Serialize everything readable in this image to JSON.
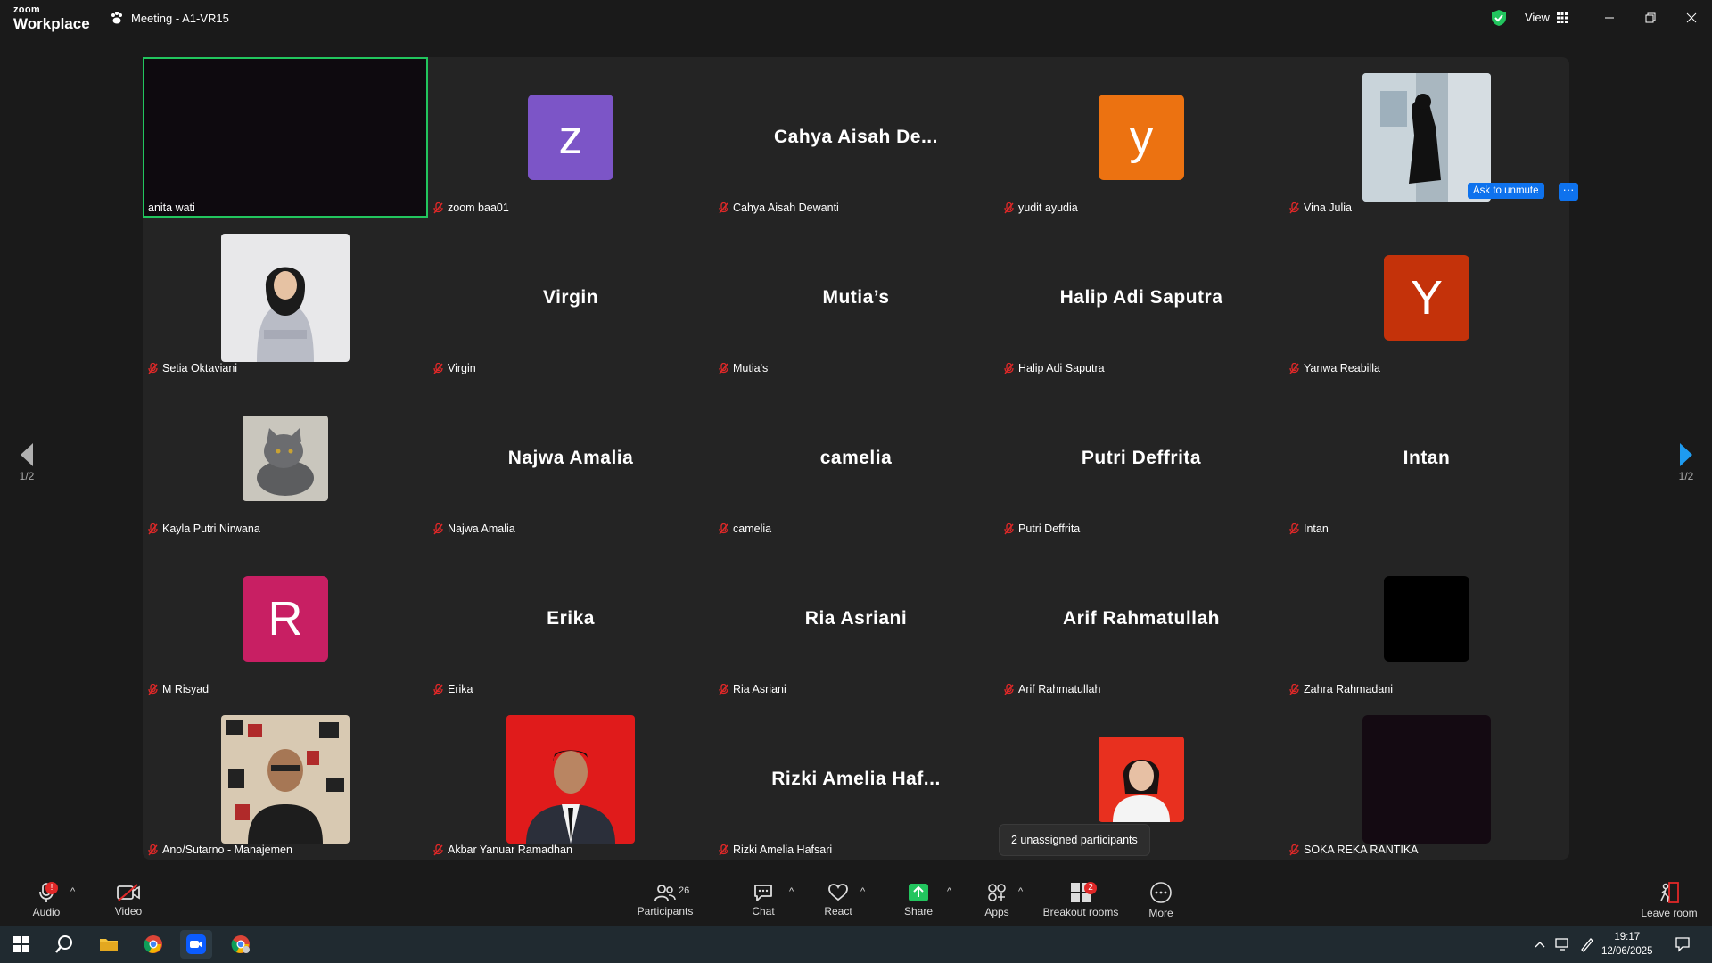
{
  "app": {
    "brand_top": "zoom",
    "brand_bottom": "Workplace",
    "meeting_title": "Meeting - A1-VR15",
    "view_label": "View"
  },
  "tiles": [
    {
      "label": "anita wati",
      "kind": "dark",
      "muted": false,
      "active": true
    },
    {
      "label": "zoom baa01",
      "kind": "avatar",
      "letter": "z",
      "color": "#7c55c7",
      "muted": true
    },
    {
      "label": "Cahya Aisah Dewanti",
      "kind": "name",
      "display": "Cahya  Aisah  De...",
      "muted": true
    },
    {
      "label": "yudit ayudia",
      "kind": "avatar",
      "letter": "y",
      "color": "#ec7211",
      "muted": true
    },
    {
      "label": "Vina Julia",
      "kind": "photo",
      "photo": "mirror-selfie",
      "muted": true
    },
    {
      "label": "Setia Oktaviani",
      "kind": "photo",
      "photo": "hijab-portrait",
      "muted": true
    },
    {
      "label": "Virgin",
      "kind": "name",
      "display": "Virgin",
      "muted": true
    },
    {
      "label": "Mutia's",
      "kind": "name",
      "display": "Mutia’s",
      "muted": true
    },
    {
      "label": "Halip Adi Saputra",
      "kind": "name",
      "display": "Halip Adi Saputra",
      "muted": true
    },
    {
      "label": "Yanwa Reabilla",
      "kind": "avatar",
      "letter": "Y",
      "color": "#c4320a",
      "muted": true
    },
    {
      "label": "Kayla Putri Nirwana",
      "kind": "photo-small",
      "photo": "cat",
      "muted": true
    },
    {
      "label": "Najwa Amalia",
      "kind": "name",
      "display": "Najwa Amalia",
      "muted": true
    },
    {
      "label": "camelia",
      "kind": "name",
      "display": "camelia",
      "muted": true
    },
    {
      "label": "Putri Deffrita",
      "kind": "name",
      "display": "Putri Deffrita",
      "muted": true
    },
    {
      "label": "Intan",
      "kind": "name",
      "display": "Intan",
      "muted": true
    },
    {
      "label": "M Risyad",
      "kind": "avatar",
      "letter": "R",
      "color": "#c81f63",
      "muted": true
    },
    {
      "label": "Erika",
      "kind": "name",
      "display": "Erika",
      "muted": true
    },
    {
      "label": "Ria Asriani",
      "kind": "name",
      "display": "Ria Asriani",
      "muted": true
    },
    {
      "label": "Arif Rahmatullah",
      "kind": "name",
      "display": "Arif Rahmatullah",
      "muted": true
    },
    {
      "label": "Zahra Rahmadani",
      "kind": "black-box",
      "muted": true
    },
    {
      "label": "Ano/Sutarno - Manajemen",
      "kind": "photo",
      "photo": "collage-man",
      "muted": true
    },
    {
      "label": "Akbar Yanuar Ramadhan",
      "kind": "photo",
      "photo": "red-formal",
      "muted": true
    },
    {
      "label": "Rizki Amelia Hafsari",
      "kind": "name",
      "display": "Rizki  Amelia  Haf...",
      "muted": true
    },
    {
      "label": "",
      "kind": "photo-small",
      "photo": "woman-red",
      "muted": false
    },
    {
      "label": "SOKA REKA RANTIKA",
      "kind": "dark-box",
      "muted": true
    }
  ],
  "ask_to_unmute": "Ask to unmute",
  "ask_more": "···",
  "page_indicator_left": "1/2",
  "page_indicator_right": "1/2",
  "tooltip": "2 unassigned participants",
  "toolbar": {
    "audio": "Audio",
    "video": "Video",
    "participants": "Participants",
    "participants_count": "26",
    "chat": "Chat",
    "react": "React",
    "share": "Share",
    "apps": "Apps",
    "breakout": "Breakout rooms",
    "breakout_badge": "2",
    "more": "More",
    "leave": "Leave room",
    "audio_badge": "!"
  },
  "taskbar": {
    "time": "19:17",
    "date": "12/06/2025"
  },
  "colors": {
    "active_border": "#22c55e",
    "accent": "#0e72ed",
    "share": "#22c55e",
    "mute_red": "#e02828"
  }
}
